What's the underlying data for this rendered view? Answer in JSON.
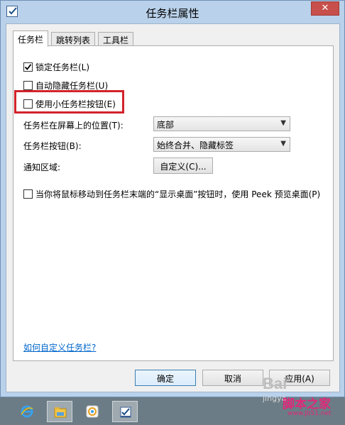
{
  "window": {
    "title": "任务栏属性",
    "close_glyph": "✕"
  },
  "tabs": [
    {
      "label": "任务栏",
      "active": true
    },
    {
      "label": "跳转列表",
      "active": false
    },
    {
      "label": "工具栏",
      "active": false
    }
  ],
  "options": {
    "lock_taskbar": {
      "label": "锁定任务栏(L)",
      "checked": true
    },
    "auto_hide": {
      "label": "自动隐藏任务栏(U)",
      "checked": false
    },
    "small_buttons": {
      "label": "使用小任务栏按钮(E)",
      "checked": false
    },
    "peek": {
      "label": "当你将鼠标移动到任务栏末端的“显示桌面”按钮时，使用 Peek 预览桌面(P)",
      "checked": false
    }
  },
  "location": {
    "label": "任务栏在屏幕上的位置(T):",
    "value": "底部"
  },
  "buttons_setting": {
    "label": "任务栏按钮(B):",
    "value": "始终合并、隐藏标签"
  },
  "notification": {
    "label": "通知区域:",
    "button": "自定义(C)..."
  },
  "help_link": "如何自定义任务栏?",
  "dialog_buttons": {
    "ok": "确定",
    "cancel": "取消",
    "apply": "应用(A)"
  },
  "taskbar": {
    "items": [
      "internet-explorer-icon",
      "file-explorer-icon",
      "photos-icon",
      "taskbar-properties-icon"
    ],
    "selected_index": 3
  },
  "watermarks": {
    "baidu": "Bai",
    "jingyan": "jingya",
    "site_cn": "脚本之家",
    "site_url": "www.Jb51.net"
  },
  "colors": {
    "highlight": "#d2232a",
    "link": "#0066cc",
    "close_button": "#c7504c"
  }
}
